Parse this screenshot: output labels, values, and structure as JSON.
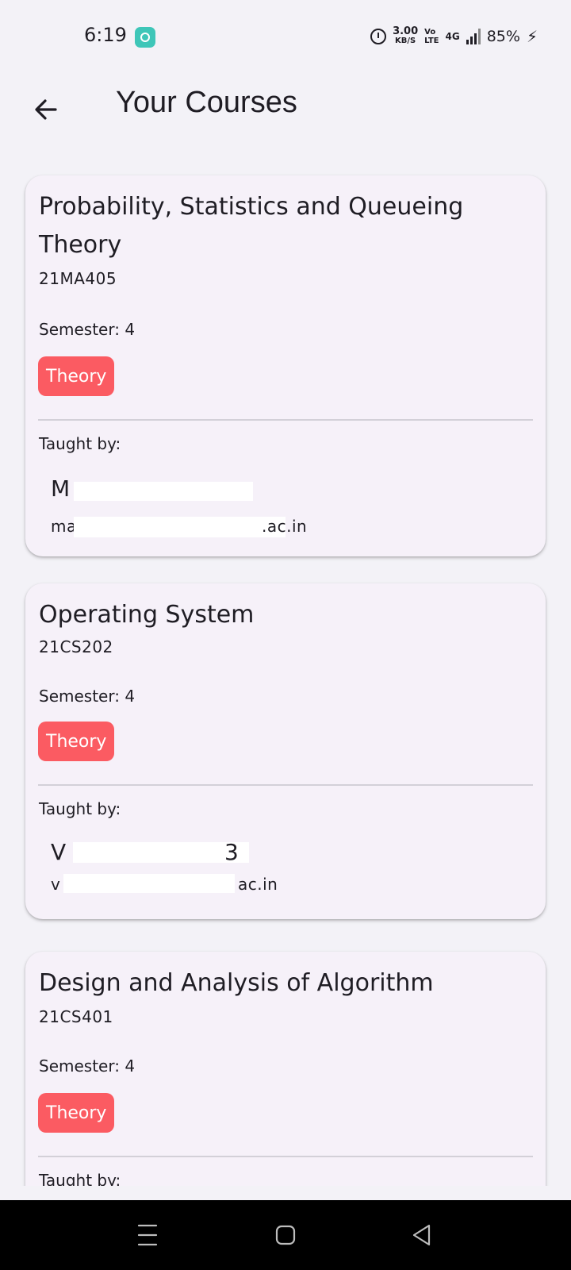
{
  "status": {
    "time": "6:19",
    "net_speed": "3.00",
    "net_unit": "KB/S",
    "volte_top": "Vo",
    "volte_bottom": "LTE",
    "network": "4G",
    "battery": "85%"
  },
  "header": {
    "title": "Your Courses",
    "back_icon": "arrow-left-icon"
  },
  "courses": [
    {
      "title": "Probability, Statistics and Queueing Theory",
      "code": "21MA405",
      "semester": "Semester: 4",
      "type": "Theory",
      "taught_by_label": "Taught by:",
      "instructor_name": "M",
      "instructor_email_prefix": "ma",
      "instructor_email_suffix": ".ac.in"
    },
    {
      "title": "Operating System",
      "code": "21CS202",
      "semester": "Semester: 4",
      "type": "Theory",
      "taught_by_label": "Taught by:",
      "instructor_name": "V",
      "instructor_name_tail": "3",
      "instructor_email_prefix": "v",
      "instructor_email_suffix": "ac.in"
    },
    {
      "title": "Design and Analysis of Algorithm",
      "code": "21CS401",
      "semester": "Semester: 4",
      "type": "Theory",
      "taught_by_label": "Taught by:"
    }
  ],
  "colors": {
    "background": "#f3f2f7",
    "card": "#f6f1f9",
    "chip": "#fb5b62",
    "divider": "#d3d0d8"
  },
  "nav": {
    "recents_icon": "recents-icon",
    "home_icon": "home-icon",
    "back_icon": "back-triangle-icon"
  }
}
